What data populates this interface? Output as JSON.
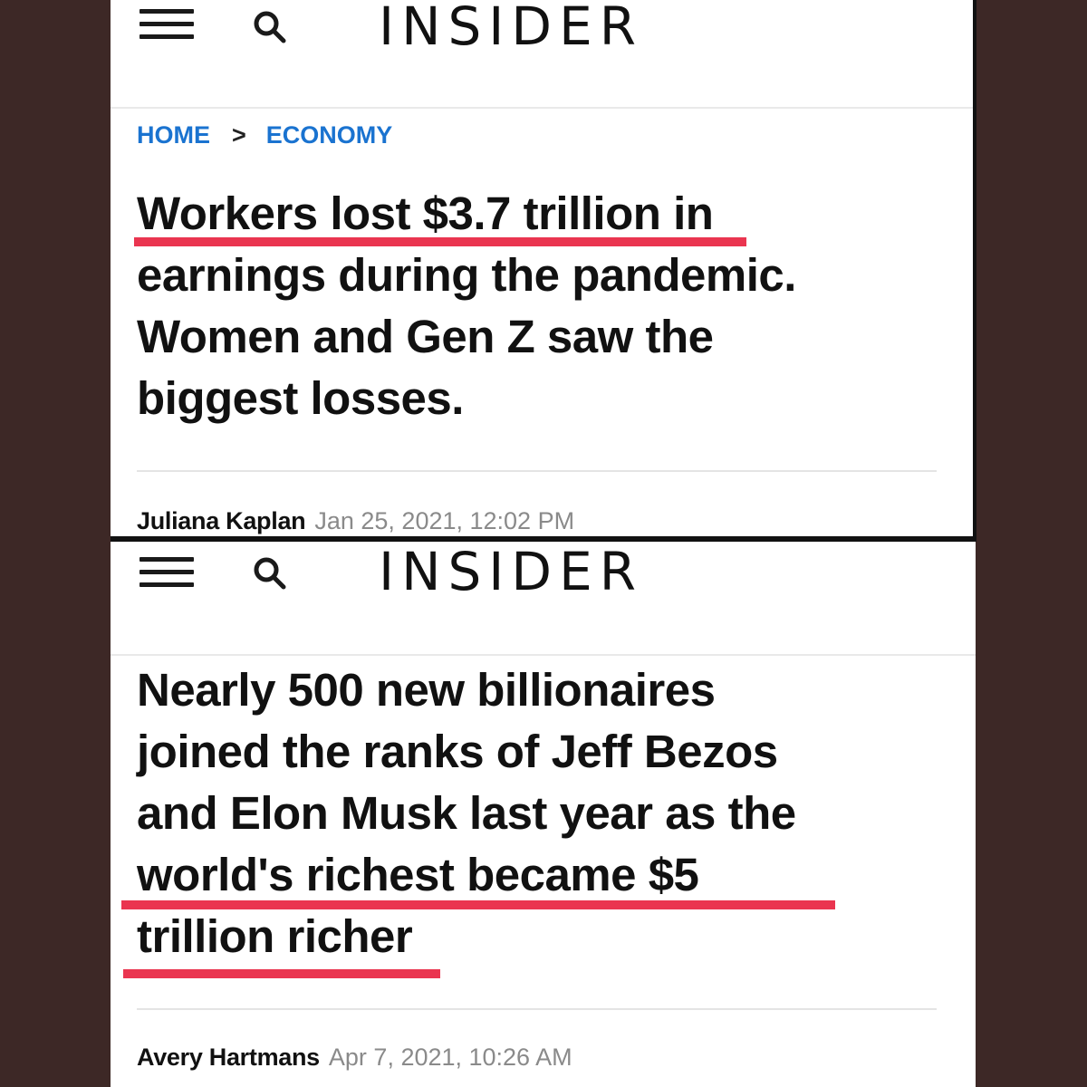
{
  "articles": [
    {
      "site": {
        "logo": "INSIDER",
        "menu_icon": "hamburger-menu-icon",
        "search_icon": "search-icon"
      },
      "breadcrumb": {
        "home": "HOME",
        "separator": ">",
        "section": "ECONOMY"
      },
      "headline_lines": [
        "Workers lost $3.7 trillion in",
        "earnings during the pandemic.",
        "Women and Gen Z saw the",
        "biggest losses."
      ],
      "highlight_text": "Workers lost $3.7 trillion",
      "author": "Juliana Kaplan",
      "date": "Jan 25, 2021, 12:02 PM"
    },
    {
      "site": {
        "logo": "INSIDER",
        "menu_icon": "hamburger-menu-icon",
        "search_icon": "search-icon"
      },
      "headline_lines": [
        "Nearly 500 new billionaires",
        "joined the ranks of Jeff Bezos",
        "and Elon Musk last year as the",
        "world's richest became $5",
        "trillion richer"
      ],
      "highlight_text": [
        "world's richest became $5",
        "trillion richer"
      ],
      "author": "Avery Hartmans",
      "date": "Apr 7, 2021, 10:26 AM"
    }
  ],
  "colors": {
    "background": "#3d2826",
    "panel": "#ffffff",
    "link_blue": "#1a73d0",
    "underline_red": "#ea3550",
    "date_gray": "#8a8a8a"
  }
}
